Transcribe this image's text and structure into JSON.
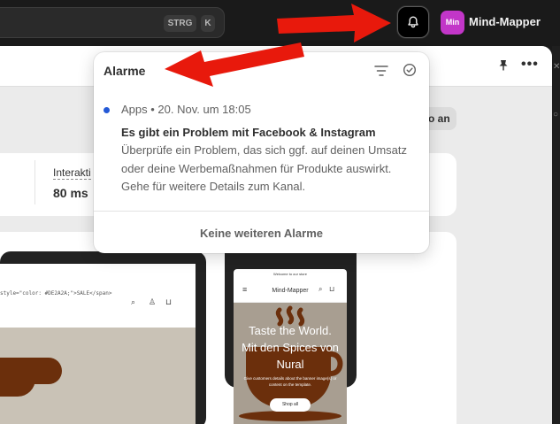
{
  "topbar": {
    "shortcut_keys": [
      "STRG",
      "K"
    ],
    "store_avatar": "Min",
    "store_name": "Mind-Mapper"
  },
  "main": {
    "pill_label": "o an",
    "metric_label": "Interakti",
    "metric_value": "80 ms"
  },
  "preview": {
    "desktop_code": "style=\"color: #DE2A2A;\">SALE</span>",
    "phone_banner": "Welcome to our store",
    "phone_store": "Mind-Mapper",
    "hero_title_lines": [
      "Taste the World.",
      "Mit den Spices von",
      "Nural"
    ],
    "hero_subtitle": "Give customers details about the banner image(s) or content on the template.",
    "hero_button": "Shop all"
  },
  "notifications": {
    "title": "Alarme",
    "items": [
      {
        "meta": "Apps • 20. Nov. um 18:05",
        "title": "Es gibt ein Problem mit Facebook & Instagram",
        "body": "Überprüfe ein Problem, das sich ggf. auf deinen Umsatz oder deine Werbemaßnahmen für Produkte auswirkt. Gehe für weitere Details zum Kanal.",
        "unread": true
      }
    ],
    "footer": "Keine weiteren Alarme"
  },
  "colors": {
    "annotation_arrow": "#e8190c",
    "unread_dot": "#2459d6",
    "store_avatar_bg": "#c236c8"
  },
  "icons": [
    "bell-icon",
    "pin-icon",
    "more-icon",
    "filter-icon",
    "check-circle-icon",
    "search-icon",
    "user-icon",
    "cart-icon",
    "menu-icon"
  ]
}
